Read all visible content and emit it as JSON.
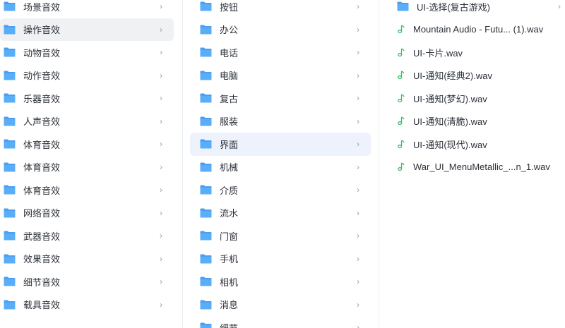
{
  "categories": {
    "items": [
      {
        "label": "场景音效",
        "selected": false
      },
      {
        "label": "操作音效",
        "selected": true
      },
      {
        "label": "动物音效",
        "selected": false
      },
      {
        "label": "动作音效",
        "selected": false
      },
      {
        "label": "乐器音效",
        "selected": false
      },
      {
        "label": "人声音效",
        "selected": false
      },
      {
        "label": "体育音效",
        "selected": false
      },
      {
        "label": "体育音效",
        "selected": false
      },
      {
        "label": "体育音效",
        "selected": false
      },
      {
        "label": "网络音效",
        "selected": false
      },
      {
        "label": "武器音效",
        "selected": false
      },
      {
        "label": "效果音效",
        "selected": false
      },
      {
        "label": "细节音效",
        "selected": false
      },
      {
        "label": "载具音效",
        "selected": false
      }
    ]
  },
  "subcategories": {
    "items": [
      {
        "label": "按钮",
        "selected": false
      },
      {
        "label": "办公",
        "selected": false
      },
      {
        "label": "电话",
        "selected": false
      },
      {
        "label": "电脑",
        "selected": false
      },
      {
        "label": "复古",
        "selected": false
      },
      {
        "label": "服装",
        "selected": false
      },
      {
        "label": "界面",
        "selected": true
      },
      {
        "label": "机械",
        "selected": false
      },
      {
        "label": "介质",
        "selected": false
      },
      {
        "label": "流水",
        "selected": false
      },
      {
        "label": "门窗",
        "selected": false
      },
      {
        "label": "手机",
        "selected": false
      },
      {
        "label": "相机",
        "selected": false
      },
      {
        "label": "消息",
        "selected": false
      },
      {
        "label": "细节",
        "selected": false
      }
    ]
  },
  "files": {
    "items": [
      {
        "label": "UI-选择(复古游戏)",
        "type": "folder"
      },
      {
        "label": "Mountain Audio - Futu... (1).wav",
        "type": "audio"
      },
      {
        "label": "UI-卡片.wav",
        "type": "audio"
      },
      {
        "label": "UI-通知(经典2).wav",
        "type": "audio"
      },
      {
        "label": "UI-通知(梦幻).wav",
        "type": "audio"
      },
      {
        "label": "UI-通知(清脆).wav",
        "type": "audio"
      },
      {
        "label": "UI-通知(现代).wav",
        "type": "audio"
      },
      {
        "label": "War_UI_MenuMetallic_...n_1.wav",
        "type": "audio"
      }
    ]
  },
  "icons": {
    "folder": "folder-icon",
    "audio": "audio-file-icon",
    "chevron": "chevron-right-icon"
  },
  "colors": {
    "folder": "#4a9ff5",
    "audio_icon": "#3cbf6a",
    "selected_bg": "#eef2fd"
  }
}
